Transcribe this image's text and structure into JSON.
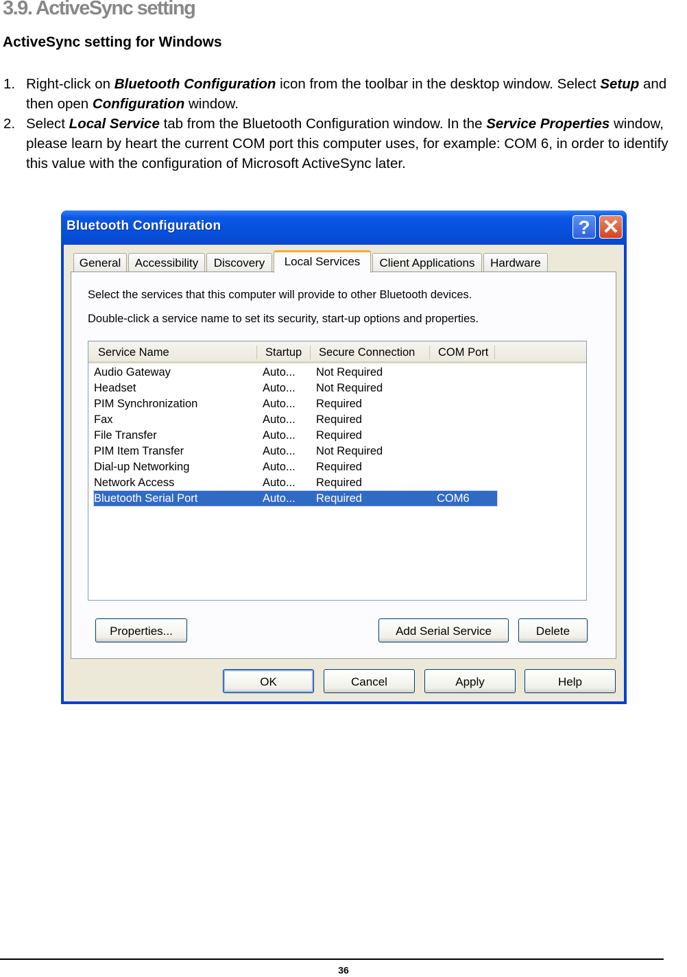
{
  "document": {
    "section_heading": "3.9. ActiveSync setting",
    "sub_heading": "ActiveSync setting for Windows",
    "steps": [
      {
        "number": "1.",
        "parts": [
          {
            "t": "Right-click on "
          },
          {
            "t": "Bluetooth Configuration",
            "b": true
          },
          {
            "t": " icon from the toolbar in the desktop window. Select "
          },
          {
            "t": "Setup",
            "b": true
          },
          {
            "t": " and then open "
          },
          {
            "t": "Configuration",
            "b": true
          },
          {
            "t": " window."
          }
        ]
      },
      {
        "number": "2.",
        "parts": [
          {
            "t": "Select "
          },
          {
            "t": "Local Service",
            "b": true
          },
          {
            "t": " tab from the Bluetooth Configuration window. In the "
          },
          {
            "t": "Service Properties",
            "b": true
          },
          {
            "t": " window, please learn by heart the current COM port this computer uses, for example: COM 6, in order to identify this value with the configuration of Microsoft ActiveSync later."
          }
        ]
      }
    ],
    "page_number": "36"
  },
  "dialog": {
    "title": "Bluetooth Configuration",
    "help_icon": "?",
    "close_icon": "✕",
    "tabs": [
      {
        "label": "General",
        "active": false
      },
      {
        "label": "Accessibility",
        "active": false
      },
      {
        "label": "Discovery",
        "active": false
      },
      {
        "label": "Local Services",
        "active": true
      },
      {
        "label": "Client Applications",
        "active": false
      },
      {
        "label": "Hardware",
        "active": false
      }
    ],
    "instructions": [
      "Select the services that this computer will provide to other Bluetooth devices.",
      "Double-click a service name to set its security, start-up options and properties."
    ],
    "list": {
      "columns": [
        "Service Name",
        "Startup",
        "Secure Connection",
        "COM Port"
      ],
      "rows": [
        {
          "name": "Audio Gateway",
          "startup": "Auto...",
          "secure": "Not Required",
          "com": "",
          "selected": false
        },
        {
          "name": "Headset",
          "startup": "Auto...",
          "secure": "Not Required",
          "com": "",
          "selected": false
        },
        {
          "name": "PIM Synchronization",
          "startup": "Auto...",
          "secure": "Required",
          "com": "",
          "selected": false
        },
        {
          "name": "Fax",
          "startup": "Auto...",
          "secure": "Required",
          "com": "",
          "selected": false
        },
        {
          "name": "File Transfer",
          "startup": "Auto...",
          "secure": "Required",
          "com": "",
          "selected": false
        },
        {
          "name": "PIM Item Transfer",
          "startup": "Auto...",
          "secure": "Not Required",
          "com": "",
          "selected": false
        },
        {
          "name": "Dial-up Networking",
          "startup": "Auto...",
          "secure": "Required",
          "com": "",
          "selected": false
        },
        {
          "name": "Network Access",
          "startup": "Auto...",
          "secure": "Required",
          "com": "",
          "selected": false
        },
        {
          "name": "Bluetooth Serial Port",
          "startup": "Auto...",
          "secure": "Required",
          "com": "COM6",
          "selected": true
        }
      ]
    },
    "panel_buttons": {
      "properties": "Properties...",
      "add_serial_service": "Add Serial Service",
      "delete": "Delete"
    },
    "dialog_buttons": {
      "ok": "OK",
      "cancel": "Cancel",
      "apply": "Apply",
      "help": "Help"
    }
  }
}
